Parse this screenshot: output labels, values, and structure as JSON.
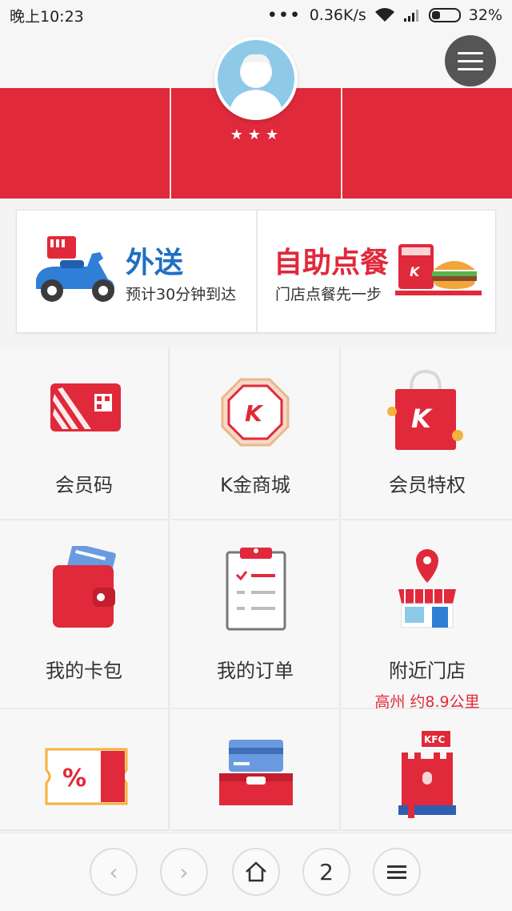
{
  "status_bar": {
    "time": "晚上10:23",
    "dots": "•••",
    "speed": "0.36K/s",
    "battery": "32%"
  },
  "header": {
    "stars": "★★★",
    "accent_color": "#e0293a"
  },
  "services": [
    {
      "title": "外送",
      "subtitle": "预计30分钟到达",
      "title_color": "#1f6fc3"
    },
    {
      "title": "自助点餐",
      "subtitle": "门店点餐先一步",
      "title_color": "#e0293a"
    }
  ],
  "grid": {
    "items": [
      {
        "label": "会员码",
        "icon": "member-code-card-icon"
      },
      {
        "label": "K金商城",
        "icon": "k-gold-coin-icon"
      },
      {
        "label": "会员特权",
        "icon": "shopping-bag-k-icon"
      },
      {
        "label": "我的卡包",
        "icon": "wallet-icon"
      },
      {
        "label": "我的订单",
        "icon": "clipboard-order-icon"
      },
      {
        "label": "附近门店",
        "icon": "store-location-icon",
        "sublabel": "高州 约8.9公里"
      },
      {
        "label": "",
        "icon": "coupon-ticket-icon"
      },
      {
        "label": "",
        "icon": "card-tray-icon"
      },
      {
        "label": "",
        "icon": "kfc-castle-book-icon"
      }
    ]
  },
  "bottom_nav": {
    "back": "‹",
    "forward": "›",
    "home": "home-icon",
    "tabs_count": "2",
    "menu": "menu-icon"
  },
  "icon_badges": {
    "k_letter": "K",
    "kfc_text": "KFC",
    "percent": "%"
  }
}
